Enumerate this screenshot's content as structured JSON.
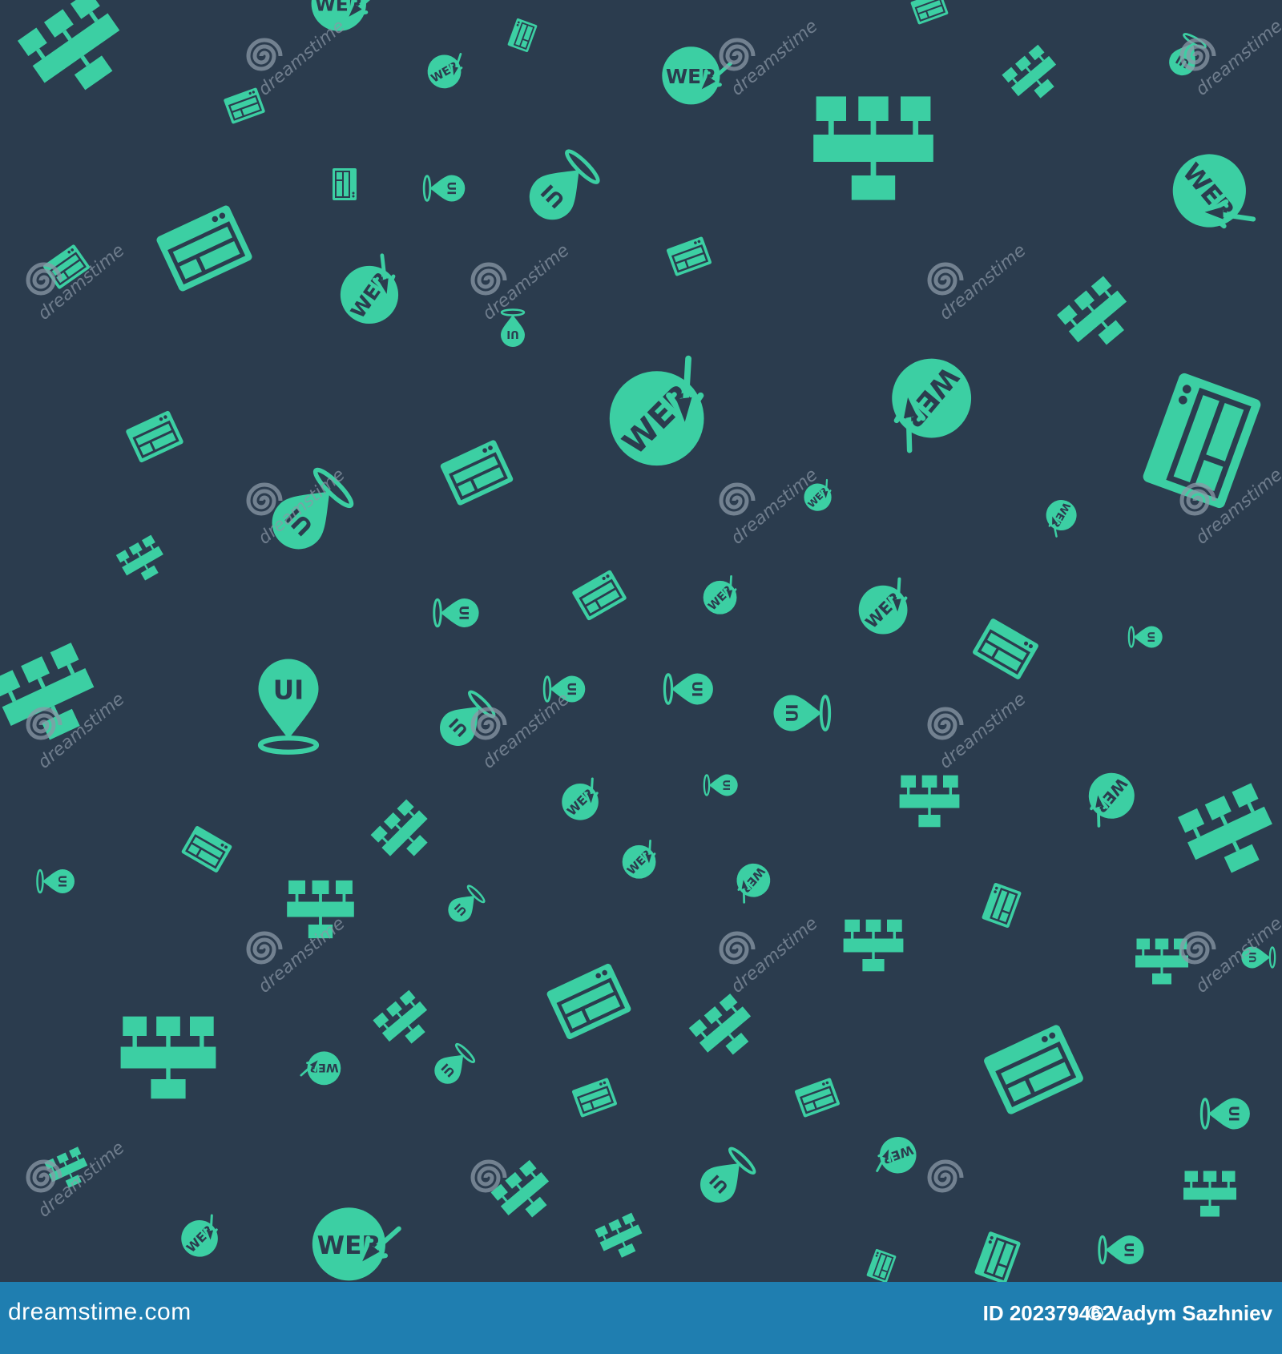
{
  "pattern": {
    "background_color": "#2b3c4e",
    "icon_color": "#3ccfa3",
    "icon_text_color": "#2b3c4e",
    "watermark_color": "#8b98a7",
    "icon_kinds": [
      "web-circle-icon",
      "ui-location-pin-icon",
      "browser-window-icon",
      "sitemap-icon"
    ],
    "icon_labels": {
      "web": "WEB",
      "ui": "UI"
    },
    "watermark_text": "dreamstime"
  },
  "footer": {
    "background_color": "#1f7eb0",
    "brand": "dreamstime.com",
    "image_id": "ID 202379462",
    "author": "© Vadym Sazhniev"
  }
}
